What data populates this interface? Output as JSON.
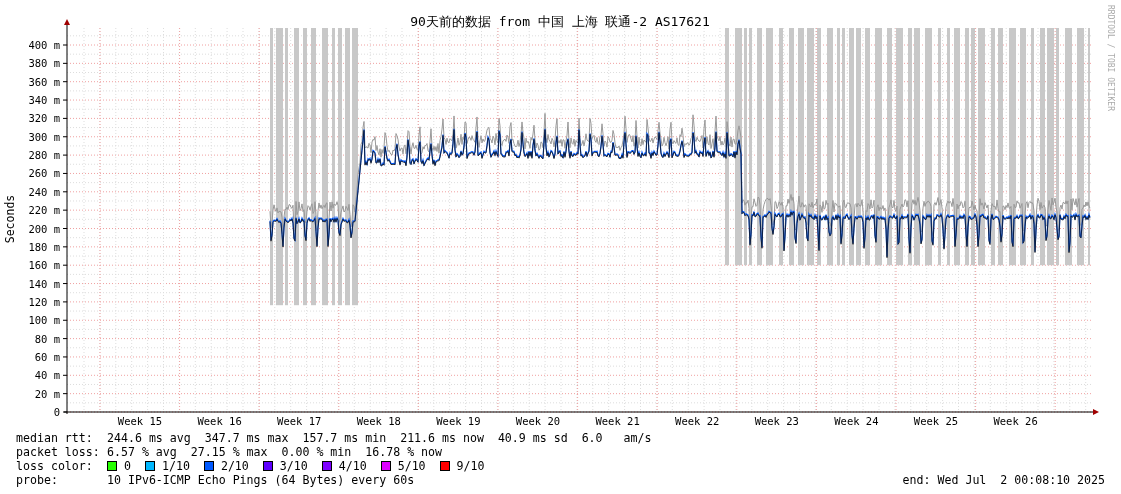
{
  "graph": {
    "title": "90天前的数据 from 中国 上海 联通-2 AS17621",
    "ylabel": "Seconds",
    "credit": "RRDTOOL / TOBI OETIKER",
    "yticks": [
      "400 m",
      "380 m",
      "360 m",
      "340 m",
      "320 m",
      "300 m",
      "280 m",
      "260 m",
      "240 m",
      "220 m",
      "200 m",
      "180 m",
      "160 m",
      "140 m",
      "120 m",
      "100 m",
      "80 m",
      "60 m",
      "40 m",
      "20 m",
      "0"
    ],
    "xlabels": [
      "Week 15",
      "Week 16",
      "Week 17",
      "Week 18",
      "Week 19",
      "Week 20",
      "Week 21",
      "Week 22",
      "Week 23",
      "Week 24",
      "Week 25",
      "Week 26"
    ]
  },
  "legend": {
    "median_rtt": {
      "label": "median rtt:",
      "text": "244.6 ms avg  347.7 ms max  157.7 ms min  211.6 ms now  40.9 ms sd  6.0   am/s"
    },
    "packet_loss": {
      "label": "packet loss:",
      "text": "6.57 % avg  27.15 % max  0.00 % min  16.78 % now"
    },
    "loss_color": {
      "label": "loss color:",
      "items": [
        {
          "label": "0",
          "color": "#26ff00"
        },
        {
          "label": "1/10",
          "color": "#00b8ff"
        },
        {
          "label": "2/10",
          "color": "#0059ff"
        },
        {
          "label": "3/10",
          "color": "#5e00ff"
        },
        {
          "label": "4/10",
          "color": "#7e00ff"
        },
        {
          "label": "5/10",
          "color": "#dd00ff"
        },
        {
          "label": "9/10",
          "color": "#ff0000"
        }
      ]
    },
    "probe": {
      "label": "probe:",
      "text": "10 IPv6-ICMP Echo Pings (64 Bytes) every 60s"
    },
    "end": "end: Wed Jul  2 00:08:10 2025"
  }
}
